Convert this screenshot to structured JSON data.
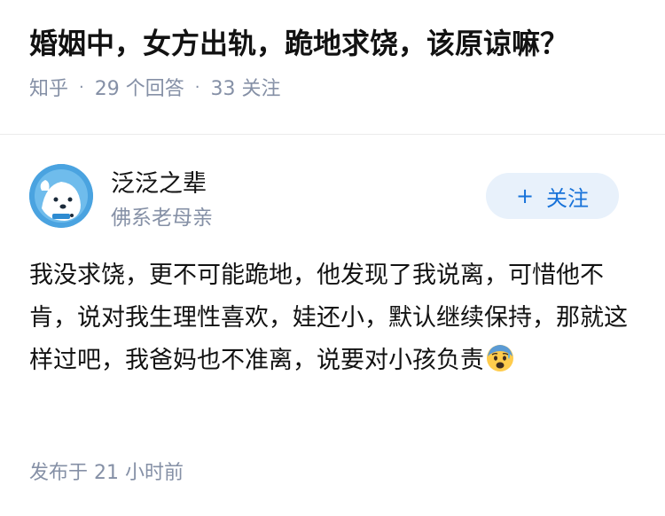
{
  "question": {
    "title": "婚姻中，女方出轨，跪地求饶，该原谅嘛？",
    "source": "知乎",
    "answer_count": "29 个回答",
    "follower_count": "33 关注",
    "separator": "·"
  },
  "author": {
    "name": "泛泛之辈",
    "bio": "佛系老母亲",
    "follow_icon": "+",
    "follow_label": "关注"
  },
  "answer": {
    "text": "我没求饶，更不可能跪地，他发现了我说离，可惜他不肯，说对我生理性喜欢，娃还小，默认继续保持，那就这样过吧，我爸妈也不准离，说要对小孩负责",
    "emoji": "anxious-face-with-sweat-icon"
  },
  "footer": {
    "published": "发布于 21 小时前"
  },
  "colors": {
    "accent": "#1772d9",
    "follow_bg": "#e8f1fb",
    "meta_gray": "#8590a6",
    "text": "#121212"
  }
}
